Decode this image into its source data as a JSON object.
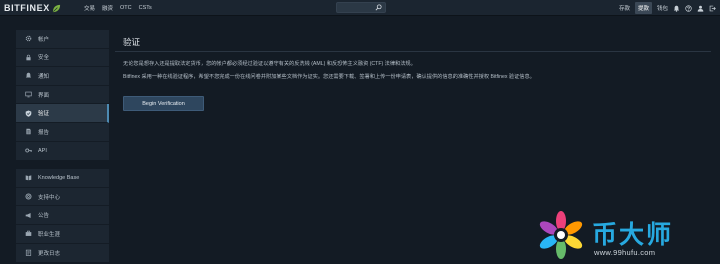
{
  "brand": {
    "name": "BITFINEX"
  },
  "nav": {
    "items": [
      "交易",
      "融资",
      "OTC",
      "CSTs"
    ]
  },
  "search": {
    "placeholder": ""
  },
  "right_nav": {
    "items": [
      "存款",
      "提款",
      "钱包"
    ],
    "active": "提款"
  },
  "sidebar": {
    "groups": [
      {
        "items": [
          "帐户",
          "安全",
          "通知",
          "界面",
          "验证",
          "报告",
          "API"
        ]
      },
      {
        "items": [
          "Knowledge Base",
          "支持中心",
          "公告",
          "职业生涯",
          "更改日志"
        ]
      }
    ],
    "active": "验证"
  },
  "main": {
    "title": "验证",
    "paragraph1": "无论您是想存入还是提取法定货币，您的帐户都必须经过验证以遵守有关的反洗钱 (AML) 和反恐怖主义融资 (CTF) 法律和法规。",
    "paragraph2": "Bitfinex 采用一种在线验证程序，希望不您完成一份在线问卷并附加某些文档作为证实。您还需要下载、签署和上传一份申请表，确认提供的信息的准确性并授权 Bitfinex 验证信息。",
    "button_label": "Begin Verification"
  },
  "watermark": {
    "brand": "币大师",
    "url": "www.99hufu.com"
  },
  "colors": {
    "background": "#131b24",
    "topbar": "#1b2530",
    "sidebar": "#1c2631",
    "active_item": "#2c3a48",
    "accent": "#4d8ab2",
    "button": "#2e465e",
    "logo_leaf": "#7cb342",
    "watermark_blue": "#27a9e0"
  }
}
